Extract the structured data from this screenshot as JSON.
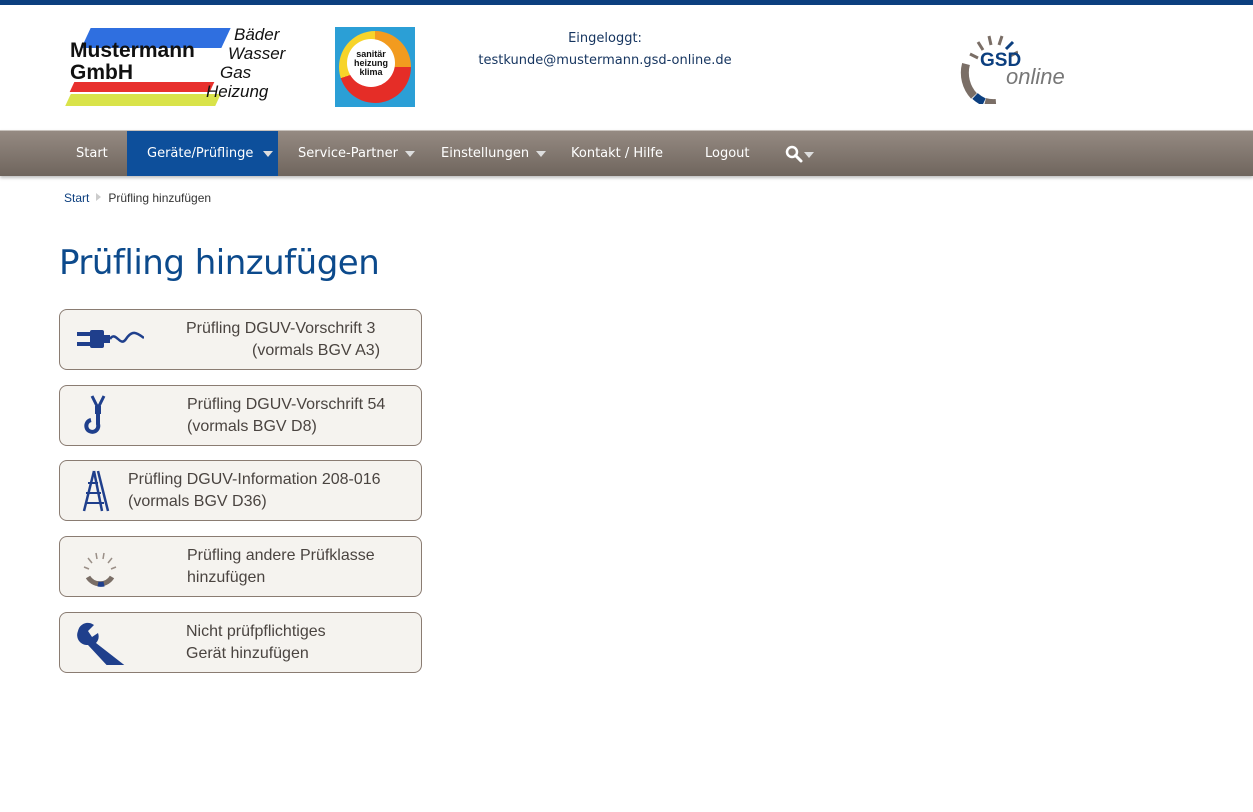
{
  "header": {
    "company_logo": {
      "name_line1": "Mustermann",
      "name_line2": "GmbH",
      "trades": [
        "Bäder",
        "Wasser",
        "Gas",
        "Heizung"
      ]
    },
    "shk_logo": {
      "line1": "sanitär",
      "line2": "heizung",
      "line3": "klima"
    },
    "login_label": "Eingeloggt:",
    "login_email": "testkunde@mustermann.gsd-online.de",
    "gsd_logo": {
      "gsd": "GSD",
      "online": "online"
    }
  },
  "nav": {
    "items": [
      {
        "label": "Start",
        "dropdown": false,
        "active": false
      },
      {
        "label": "Geräte/Prüflinge",
        "dropdown": true,
        "active": true
      },
      {
        "label": "Service-Partner",
        "dropdown": true,
        "active": false
      },
      {
        "label": "Einstellungen",
        "dropdown": true,
        "active": false
      },
      {
        "label": "Kontakt / Hilfe",
        "dropdown": false,
        "active": false
      },
      {
        "label": "Logout",
        "dropdown": false,
        "active": false
      }
    ],
    "search_icon": "magnifier-icon"
  },
  "breadcrumb": {
    "home": "Start",
    "current": "Prüfling hinzufügen"
  },
  "page_title": "Prüfling hinzufügen",
  "buttons": [
    {
      "icon": "plug-icon",
      "line1": "Prüfling DGUV-Vorschrift 3",
      "line2": "(vormals BGV A3)"
    },
    {
      "icon": "crane-hook-icon",
      "line1": "Prüfling DGUV-Vorschrift 54",
      "line2": "(vormals BGV D8)"
    },
    {
      "icon": "ladder-icon",
      "line1": "Prüfling DGUV-Information 208-016",
      "line2": "(vormals BGV D36)"
    },
    {
      "icon": "gsd-gauge-icon",
      "line1": "Prüfling andere Prüfklasse",
      "line2": "hinzufügen"
    },
    {
      "icon": "wrench-icon",
      "line1": "Nicht prüfpflichtiges",
      "line2": "Gerät hinzufügen"
    }
  ],
  "colors": {
    "brand_blue": "#0c3f7f",
    "nav_active": "#0d4f9b",
    "nav_bg": "#7f756d",
    "title": "#0c4a8c"
  }
}
